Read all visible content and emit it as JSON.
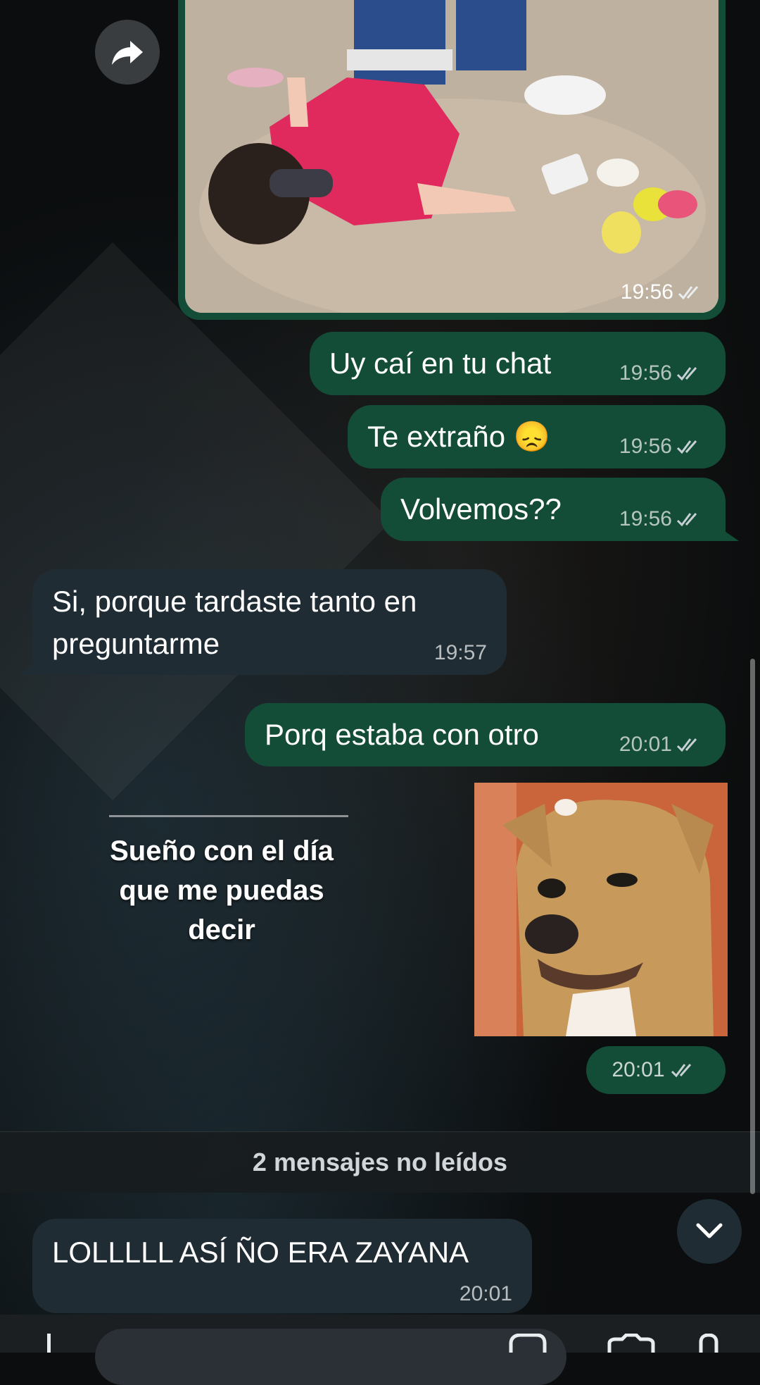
{
  "messages": [
    {
      "text": "Uy caí en tu chat",
      "time": "19:56"
    },
    {
      "text": "Te extraño",
      "emoji": "😞",
      "time": "19:56"
    },
    {
      "text": "Volvemos??",
      "time": "19:56"
    },
    {
      "text_line1": "Si, porque tardaste tanto en",
      "text_line2": "preguntarme",
      "time": "19:57"
    },
    {
      "text": "Porq estaba con otro",
      "time": "20:01"
    },
    {
      "text": "LOLLLLL ASÍ ÑO ERA ZAYANA",
      "time": "20:01"
    }
  ],
  "photo_message": {
    "time": "19:56"
  },
  "sticker": {
    "line1": "Sueño con el día",
    "line2": "que me puedas",
    "line3": "decir"
  },
  "dog_message": {
    "time": "20:01"
  },
  "unread_banner": "2 mensajes no leídos",
  "icons": [
    "forward-icon",
    "double-check-icon",
    "chevron-down-icon",
    "camera-icon",
    "mic-icon",
    "sticker-icon",
    "plus-icon"
  ],
  "colors": {
    "outgoing": "#144d37",
    "incoming": "#202c33",
    "background": "#0b0d0e"
  }
}
